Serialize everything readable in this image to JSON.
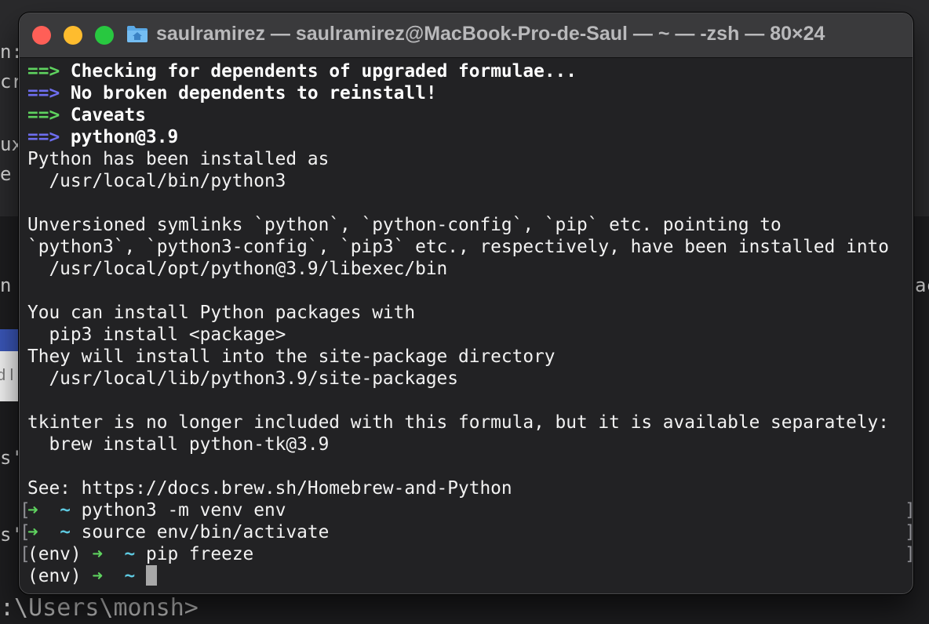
{
  "background": {
    "fragments": [
      "n:",
      "cr",
      "ux",
      "e",
      "n t",
      "ac",
      "s'",
      "s'",
      "d l"
    ],
    "bottom_prompt": ":\\Users\\monsh>"
  },
  "window": {
    "title": "saulramirez — saulramirez@MacBook-Pro-de-Saul — ~ — -zsh — 80×24",
    "icon": "folder-home-icon"
  },
  "terminal": {
    "arrow": "==>",
    "headers": [
      "Checking for dependents of upgraded formulae...",
      "No broken dependents to reinstall!",
      "Caveats",
      "python@3.9"
    ],
    "output": [
      "Python has been installed as",
      "  /usr/local/bin/python3",
      "",
      "Unversioned symlinks `python`, `python-config`, `pip` etc. pointing to",
      "`python3`, `python3-config`, `pip3` etc., respectively, have been installed into",
      "  /usr/local/opt/python@3.9/libexec/bin",
      "",
      "You can install Python packages with",
      "  pip3 install <package>",
      "They will install into the site-package directory",
      "  /usr/local/lib/python3.9/site-packages",
      "",
      "tkinter is no longer included with this formula, but it is available separately:",
      "  brew install python-tk@3.9",
      "",
      "See: https://docs.brew.sh/Homebrew-and-Python"
    ],
    "prompt_arrow": "➜",
    "prompt_dir": "~",
    "env_prefix": "(env)",
    "commands": [
      "python3 -m venv env",
      "source env/bin/activate",
      "pip freeze"
    ],
    "bracket_open": "[",
    "bracket_close": "]"
  },
  "colors": {
    "arrow_green": "#5fd35f",
    "arrow_blue": "#6e6ef0",
    "dir_cyan": "#5ec9e0",
    "close": "#ff5f57",
    "minimize": "#febc2e",
    "zoom": "#28c840"
  }
}
